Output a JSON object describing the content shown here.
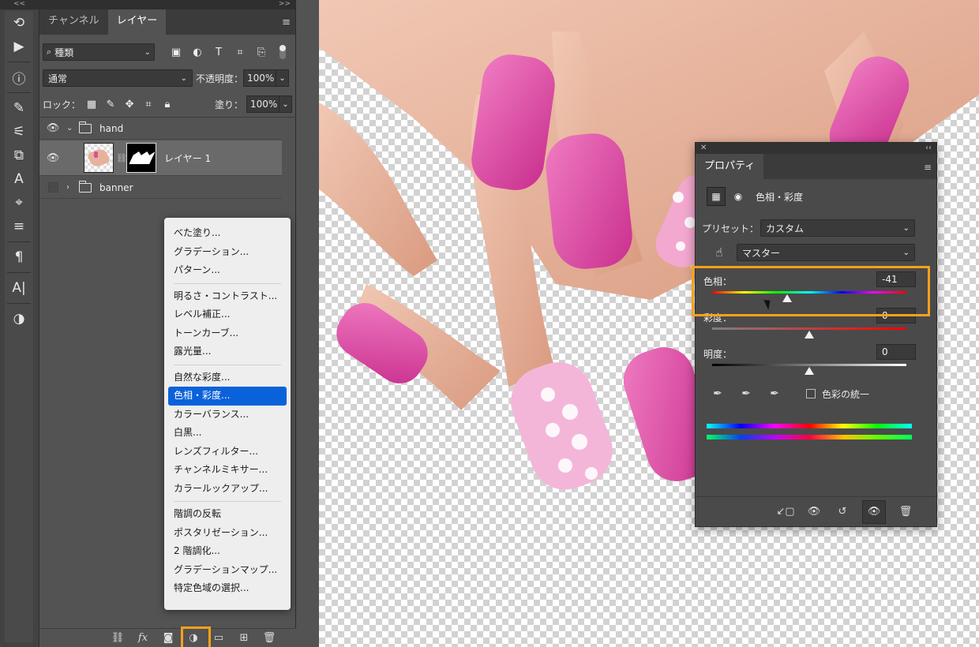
{
  "tools": {
    "collapse": "<<",
    "items": [
      {
        "name": "history-brush-icon",
        "glyph": "⟲"
      },
      {
        "name": "play-icon",
        "glyph": "▶"
      },
      {
        "name": "info-icon",
        "glyph": "ⓘ"
      },
      {
        "name": "brush-presets-icon",
        "glyph": "✎"
      },
      {
        "name": "adjust-sliders-icon",
        "glyph": "⚟"
      },
      {
        "name": "clone-source-icon",
        "glyph": "⧉"
      },
      {
        "name": "type-icon",
        "glyph": "A"
      },
      {
        "name": "path-icon",
        "glyph": "⌖"
      },
      {
        "name": "properties-sliders-icon",
        "glyph": "≡"
      },
      {
        "name": "paragraph-icon",
        "glyph": "¶"
      },
      {
        "name": "character-icon",
        "glyph": "A|"
      },
      {
        "name": "adjustments-icon",
        "glyph": "◑"
      }
    ]
  },
  "layers_panel": {
    "collapse": "<<",
    "expand": ">>",
    "tabs": [
      "チャンネル",
      "レイヤー"
    ],
    "active_tab": "レイヤー",
    "filter": {
      "value": "種類"
    },
    "blend_mode": "通常",
    "opacity_label": "不透明度：",
    "opacity": "100%",
    "lock_label": "ロック：",
    "fill_label": "塗り：",
    "fill": "100%",
    "layers": [
      {
        "name": "hand",
        "type": "group",
        "visible": true,
        "expanded": true
      },
      {
        "name": "レイヤー 1",
        "type": "layer",
        "visible": true,
        "selected": true
      },
      {
        "name": "banner",
        "type": "group",
        "visible": false,
        "expanded": false
      }
    ]
  },
  "adjustment_menu": {
    "groups": [
      [
        "べた塗り...",
        "グラデーション...",
        "パターン..."
      ],
      [
        "明るさ・コントラスト...",
        "レベル補正...",
        "トーンカーブ...",
        "露光量..."
      ],
      [
        "自然な彩度...",
        "色相・彩度...",
        "カラーバランス...",
        "白黒...",
        "レンズフィルター...",
        "チャンネルミキサー...",
        "カラールックアップ..."
      ],
      [
        "階調の反転",
        "ポスタリゼーション...",
        "2 階調化...",
        "グラデーションマップ...",
        "特定色域の選択..."
      ]
    ],
    "selected": "色相・彩度..."
  },
  "properties_panel": {
    "tab": "プロパティ",
    "adjustment_title": "色相・彩度",
    "preset_label": "プリセット：",
    "preset_value": "カスタム",
    "channel_value": "マスター",
    "hue_label": "色相：",
    "hue_value": "-41",
    "hue_fraction": 0.386,
    "saturation_label": "彩度：",
    "saturation_value": "0",
    "saturation_fraction": 0.5,
    "lightness_label": "明度：",
    "lightness_value": "0",
    "lightness_fraction": 0.5,
    "colorize_label": "色彩の統一",
    "colorize_checked": false
  },
  "colors": {
    "highlight": "#f7a11b",
    "menu_selected": "#0a62da",
    "nail_pink": "#e04ea8",
    "skin": "#eab49c"
  }
}
